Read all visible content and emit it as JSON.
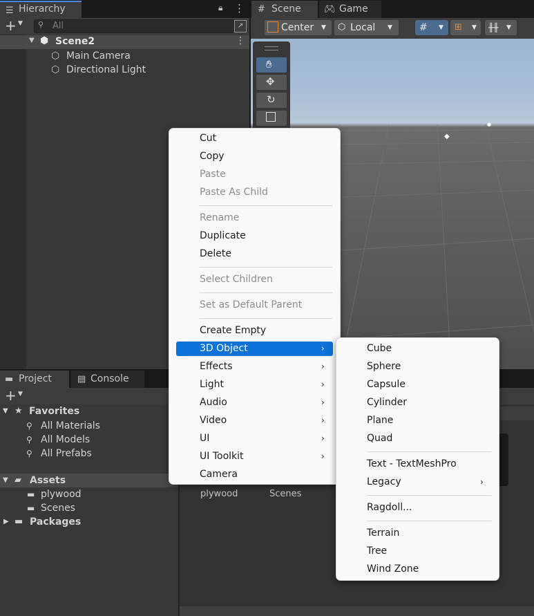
{
  "hierarchy": {
    "tab_label": "Hierarchy",
    "search_placeholder": "All",
    "scene_name": "Scene2",
    "objects": [
      "Main Camera",
      "Directional Light"
    ]
  },
  "scene_view": {
    "tabs": [
      "Scene",
      "Game"
    ],
    "pivot_mode": "Center",
    "pivot_rotation": "Local"
  },
  "project": {
    "tabs": [
      "Project",
      "Console"
    ],
    "favorites_label": "Favorites",
    "favorites": [
      "All Materials",
      "All Models",
      "All Prefabs"
    ],
    "assets_label": "Assets",
    "assets": [
      "plywood",
      "Scenes"
    ],
    "packages_label": "Packages",
    "grid_items": [
      "plywood",
      "Scenes"
    ]
  },
  "context_menu": {
    "items": [
      {
        "label": "Cut",
        "enabled": true
      },
      {
        "label": "Copy",
        "enabled": true
      },
      {
        "label": "Paste",
        "enabled": false
      },
      {
        "label": "Paste As Child",
        "enabled": false
      },
      {
        "label": "Rename",
        "enabled": false
      },
      {
        "label": "Duplicate",
        "enabled": true
      },
      {
        "label": "Delete",
        "enabled": true
      },
      {
        "label": "Select Children",
        "enabled": false
      },
      {
        "label": "Set as Default Parent",
        "enabled": false
      },
      {
        "label": "Create Empty",
        "enabled": true
      },
      {
        "label": "3D Object",
        "enabled": true,
        "submenu": true,
        "highlighted": true
      },
      {
        "label": "Effects",
        "enabled": true,
        "submenu": true
      },
      {
        "label": "Light",
        "enabled": true,
        "submenu": true
      },
      {
        "label": "Audio",
        "enabled": true,
        "submenu": true
      },
      {
        "label": "Video",
        "enabled": true,
        "submenu": true
      },
      {
        "label": "UI",
        "enabled": true,
        "submenu": true
      },
      {
        "label": "UI Toolkit",
        "enabled": true,
        "submenu": true
      },
      {
        "label": "Camera",
        "enabled": true
      }
    ],
    "submenu_arrow": "›"
  },
  "submenu_3d_object": {
    "items": [
      "Cube",
      "Sphere",
      "Capsule",
      "Cylinder",
      "Plane",
      "Quad",
      "Text - TextMeshPro",
      "Legacy",
      "Ragdoll...",
      "Terrain",
      "Tree",
      "Wind Zone"
    ]
  },
  "colors": {
    "highlight": "#0a72d8",
    "editor_bg": "#383838",
    "menu_bg": "#f9f9f9"
  }
}
